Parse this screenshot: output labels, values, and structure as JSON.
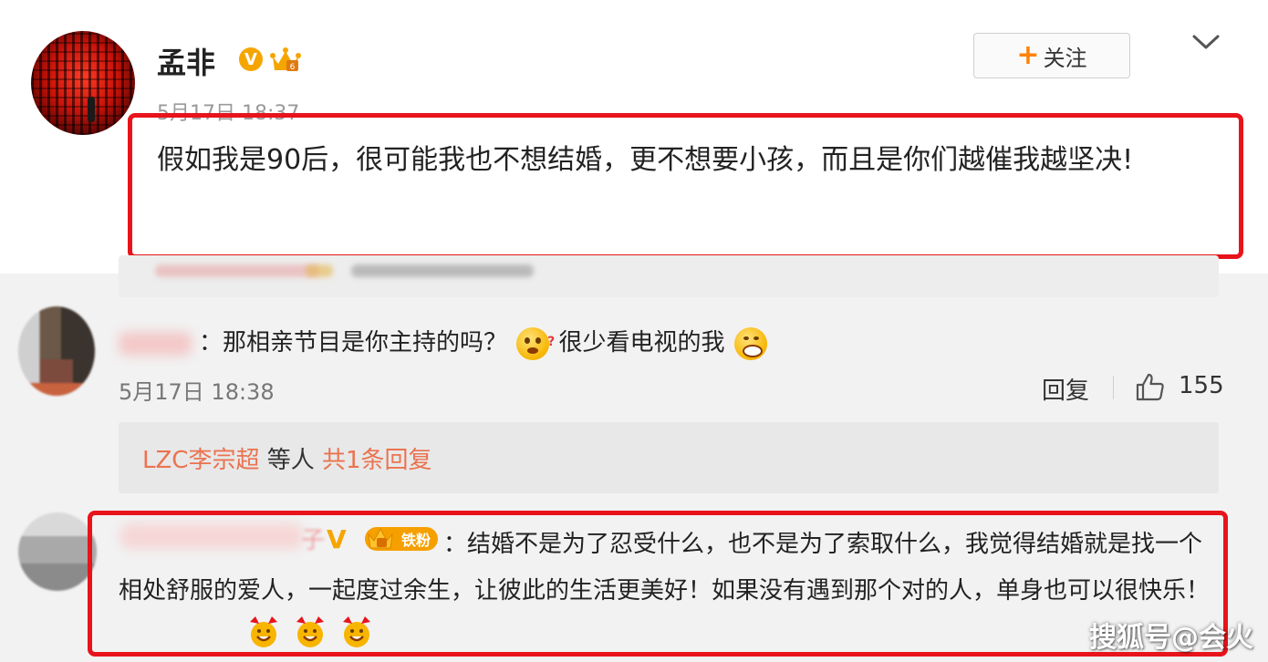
{
  "post": {
    "username": "孟非",
    "v_badge": "V",
    "follow_plus": "+",
    "follow_label": "关注",
    "time": "5月17日 18:37",
    "text": "假如我是90后，很可能我也不想结婚，更不想要小孩，而且是你们越催我越坚决!"
  },
  "comment1": {
    "text_before_emoji": "：那相亲节目是你主持的吗？",
    "text_after_emoji": "很少看电视的我",
    "time": "5月17日 18:38",
    "reply_label": "回复",
    "like_count": "155",
    "reply_summary": {
      "name": "LZC李宗超",
      "middle": " 等人 ",
      "count": "共1条回复"
    }
  },
  "comment2": {
    "name_tail": "子",
    "v_badge": "V",
    "fan_badge": "铁粉",
    "text": "：结婚不是为了忍受什么，也不是为了索取什么，我觉得结婚就是找一个相处舒服的爱人，一起度过余生，让彼此的生活更美好！如果没有遇到那个对的人，单身也可以很快乐！"
  },
  "watermark": "搜狐号@会火",
  "colors": {
    "highlight_border": "#e8141b",
    "link_orange": "#eb7350",
    "badge_gold": "#f5a500"
  },
  "icons": [
    "chevron-down-icon",
    "thumb-up-icon",
    "crown-badge-icon",
    "emoji-confused-icon",
    "emoji-grin-icon",
    "emoji-cheer-icon"
  ]
}
